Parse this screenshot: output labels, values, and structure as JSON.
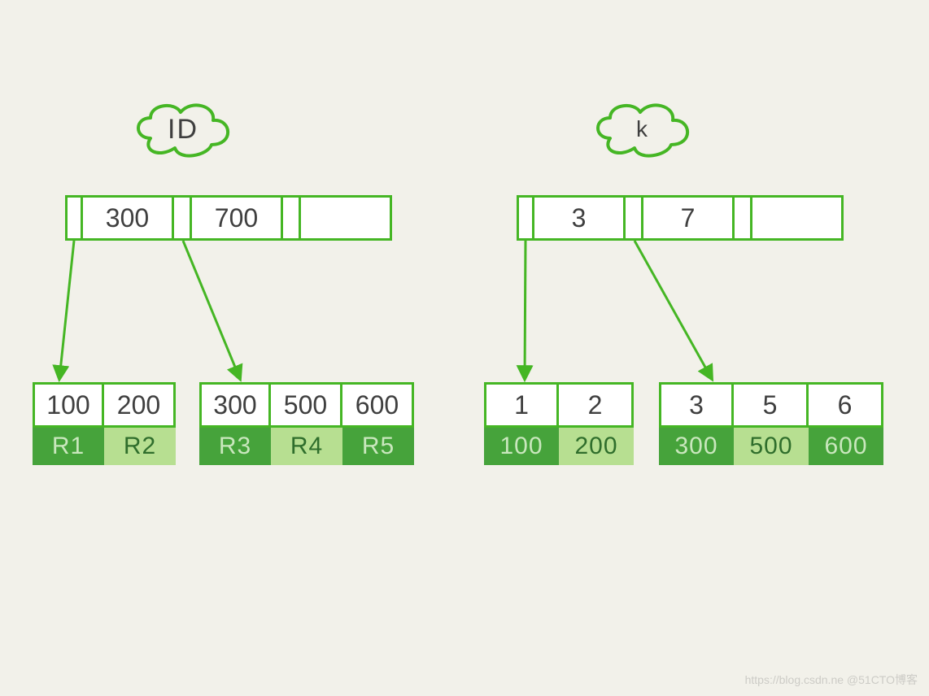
{
  "colors": {
    "bg": "#f2f1ea",
    "stroke": "#45b624",
    "leaf_dark": "#46a33b",
    "leaf_light": "#b7df91"
  },
  "left": {
    "label": "ID",
    "root": {
      "keys": [
        "300",
        "700"
      ],
      "trailing_slots": 1
    },
    "leaves": [
      {
        "keys": [
          "100",
          "200"
        ],
        "data": [
          "R1",
          "R2"
        ]
      },
      {
        "keys": [
          "300",
          "500",
          "600"
        ],
        "data": [
          "R3",
          "R4",
          "R5"
        ]
      }
    ]
  },
  "right": {
    "label": "k",
    "root": {
      "keys": [
        "3",
        "7"
      ],
      "trailing_slots": 1
    },
    "leaves": [
      {
        "keys": [
          "1",
          "2"
        ],
        "data": [
          "100",
          "200"
        ]
      },
      {
        "keys": [
          "3",
          "5",
          "6"
        ],
        "data": [
          "300",
          "500",
          "600"
        ]
      }
    ]
  },
  "watermark": "https://blog.csdn.ne  @51CTO博客"
}
